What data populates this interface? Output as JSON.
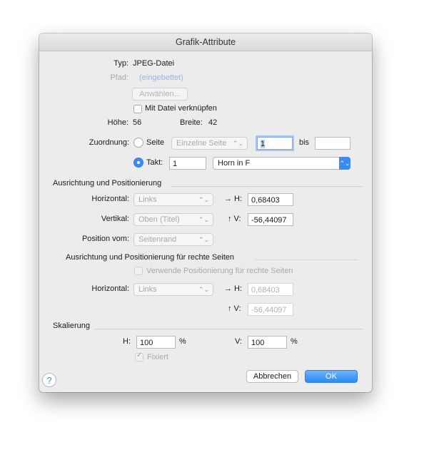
{
  "window": {
    "title": "Grafik-Attribute"
  },
  "info": {
    "typ_label": "Typ:",
    "typ_value": "JPEG-Datei",
    "pfad_label": "Pfad:",
    "pfad_value": "(eingebettet)",
    "choose_button": "Anwählen...",
    "link_checkbox": {
      "label": "Mit Datei verknüpfen",
      "checked": false
    },
    "hoehe_label": "Höhe:",
    "hoehe_value": "56",
    "breite_label": "Breite:",
    "breite_value": "42"
  },
  "zuordnung": {
    "label": "Zuordnung:",
    "seite": {
      "label": "Seite",
      "selected": false,
      "popup_value": "Einzelne Seite",
      "from_value": "1",
      "bis_label": "bis",
      "to_value": ""
    },
    "takt": {
      "label": "Takt:",
      "selected": true,
      "value": "1",
      "instrument": "Horn in F"
    }
  },
  "ausrichtung": {
    "title": "Ausrichtung und Positionierung",
    "horizontal_label": "Horizontal:",
    "horizontal_value": "Links",
    "h_label": "→ H:",
    "h_value": "0,68403",
    "vertikal_label": "Vertikal:",
    "vertikal_value": "Oben (Titel)",
    "v_label": "↑ V:",
    "v_value": "-56,44097",
    "position_label": "Position vom:",
    "position_value": "Seitenrand"
  },
  "rechte_seiten": {
    "title": "Ausrichtung und Positionierung für rechte Seiten",
    "use_checkbox": {
      "label": "Verwende Positionierung für rechte Seiten",
      "checked": false
    },
    "horizontal_label": "Horizontal:",
    "horizontal_value": "Links",
    "h_label": "→ H:",
    "h_value": "0,68403",
    "v_label": "↑ V:",
    "v_value": "-56,44097"
  },
  "skalierung": {
    "title": "Skalierung",
    "h_label": "H:",
    "h_value": "100",
    "h_unit": "%",
    "v_label": "V:",
    "v_value": "100",
    "v_unit": "%",
    "fixiert": {
      "label": "Fixiert",
      "checked": true
    }
  },
  "buttons": {
    "help": "?",
    "cancel": "Abbrechen",
    "ok": "OK"
  },
  "icons": {
    "stepper": "⌃⌄",
    "check": "✓"
  },
  "colors": {
    "accent": "#3b8cf2",
    "link": "#9db4d8"
  }
}
